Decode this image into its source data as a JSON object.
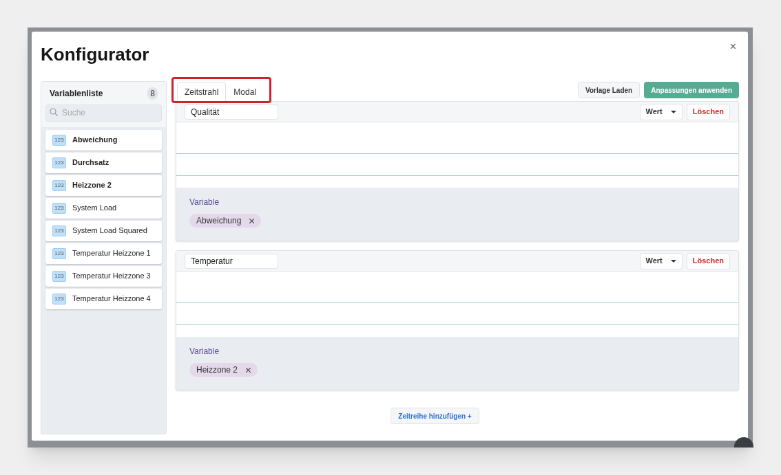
{
  "dialog": {
    "title": "Konfigurator",
    "close": "×"
  },
  "sidebar": {
    "title": "Variablenliste",
    "count": "8",
    "search": {
      "placeholder": "Suche"
    },
    "items": [
      {
        "icon": "123",
        "label": "Abweichung",
        "used": true
      },
      {
        "icon": "123",
        "label": "Durchsatz",
        "used": true
      },
      {
        "icon": "123",
        "label": "Heizzone 2",
        "used": true
      },
      {
        "icon": "123",
        "label": "System Load",
        "used": false
      },
      {
        "icon": "123",
        "label": "System Load Squared",
        "used": false
      },
      {
        "icon": "123",
        "label": "Temperatur Heizzone 1",
        "used": false
      },
      {
        "icon": "123",
        "label": "Temperatur Heizzone 3",
        "used": false
      },
      {
        "icon": "123",
        "label": "Temperatur Heizzone 4",
        "used": false
      }
    ]
  },
  "tabs": [
    {
      "label": "Zeitstrahl",
      "selected": true
    },
    {
      "label": "Modal",
      "selected": false
    }
  ],
  "toolbar": {
    "load": "Vorlage Laden",
    "apply": "Anpassungen anwenden"
  },
  "series": [
    {
      "name": "Qualität",
      "mode": "Wert",
      "delete": "Löschen",
      "variable_label": "Variable",
      "chips": [
        "Abweichung"
      ]
    },
    {
      "name": "Temperatur",
      "mode": "Wert",
      "delete": "Löschen",
      "variable_label": "Variable",
      "chips": [
        "Heizzone 2"
      ]
    }
  ],
  "add_button": "Zeitreihe hinzufügen +"
}
